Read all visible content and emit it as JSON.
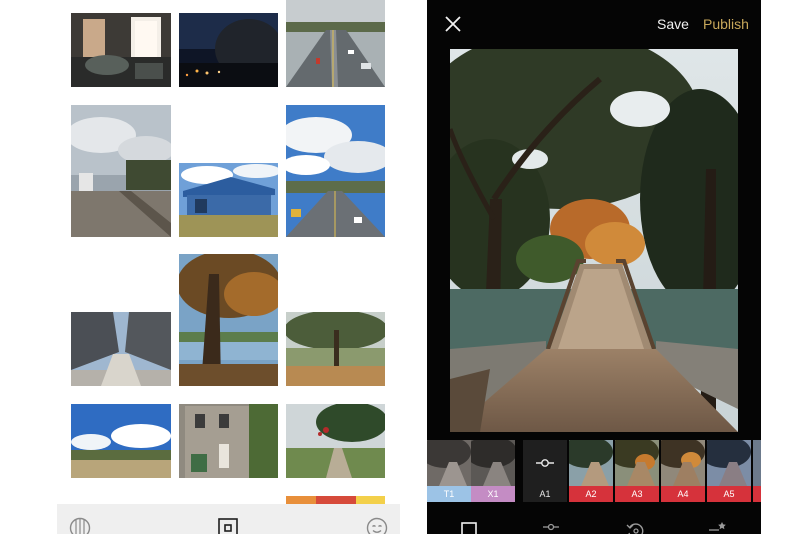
{
  "gallery": {
    "tiles": [
      {
        "name": "tile-living-room",
        "scene": "room"
      },
      {
        "name": "tile-night-street",
        "scene": "night"
      },
      {
        "name": "tile-highway-top",
        "scene": "highway"
      },
      {
        "name": "tile-railroad",
        "scene": "rail"
      },
      {
        "name": "tile-blue-shed",
        "scene": "shed"
      },
      {
        "name": "tile-highway-clouds",
        "scene": "highway2"
      },
      {
        "name": "tile-overpass",
        "scene": "overpass"
      },
      {
        "name": "tile-big-tree",
        "scene": "bigtree"
      },
      {
        "name": "tile-park-tree",
        "scene": "park"
      },
      {
        "name": "tile-blue-sky-field",
        "scene": "sky"
      },
      {
        "name": "tile-stone-building",
        "scene": "building"
      },
      {
        "name": "tile-garden-path",
        "scene": "garden"
      },
      {
        "name": "tile-mural",
        "scene": "mural"
      }
    ],
    "tabbar": {
      "icons": [
        "globe-icon",
        "library-icon",
        "profile-icon"
      ],
      "active": "library-icon"
    }
  },
  "editor": {
    "save_label": "Save",
    "publish_label": "Publish",
    "colors": {
      "publish": "#c8a85b",
      "text": "#f1f1f1",
      "background": "#050505"
    },
    "filters": [
      {
        "label": "T1",
        "color": "#9cc3e6"
      },
      {
        "label": "X1",
        "color": "#c48cc4"
      },
      {
        "label": "A1",
        "color": "#1f1f1f",
        "active": true
      },
      {
        "label": "A2",
        "color": "#d6323b"
      },
      {
        "label": "A3",
        "color": "#d6323b"
      },
      {
        "label": "A4",
        "color": "#d6323b"
      },
      {
        "label": "A5",
        "color": "#d6323b"
      }
    ],
    "toolbar_icons": [
      "crop-icon",
      "adjust-sliders-icon",
      "history-icon",
      "presets-icon"
    ]
  }
}
